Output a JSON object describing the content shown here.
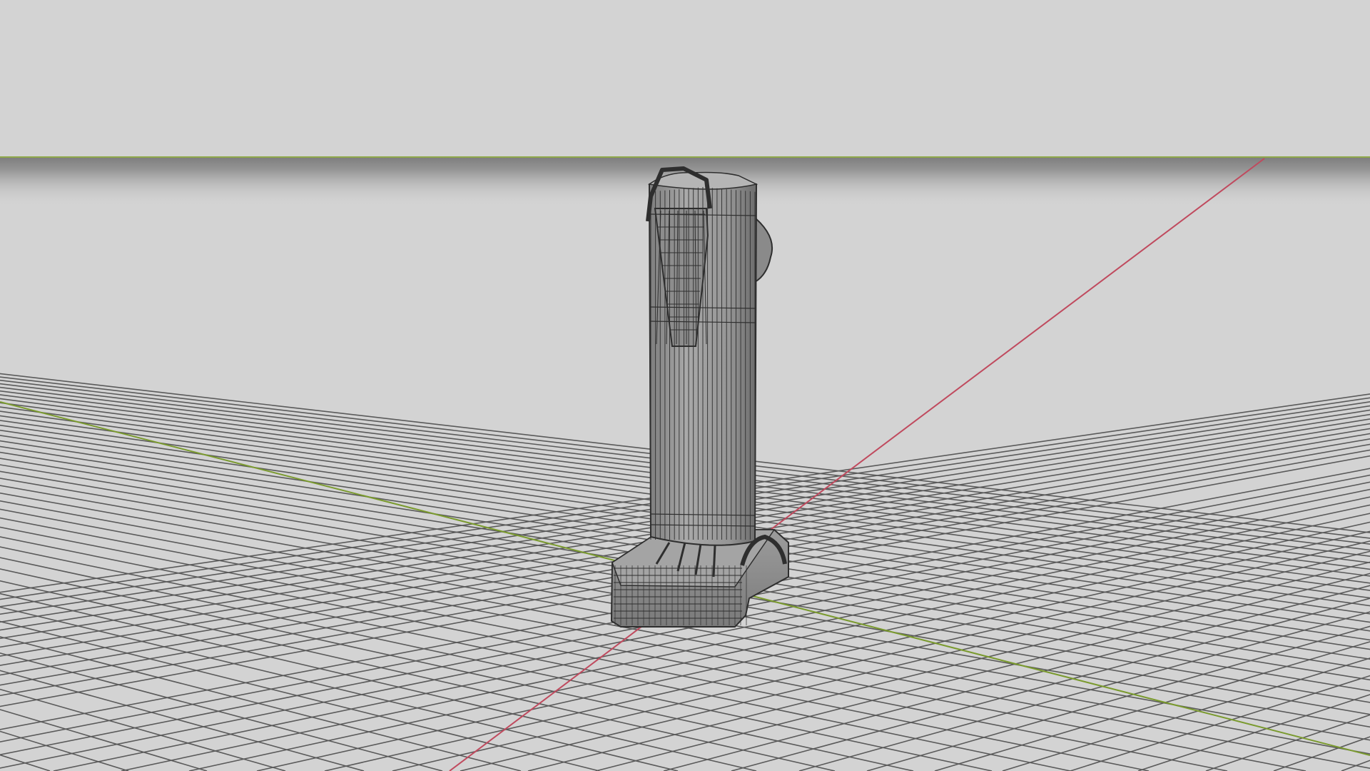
{
  "viewport": {
    "kind": "3d-perspective-viewport",
    "shading": "wireframe-on-shaded",
    "background_color": "#d3d3d3",
    "grid_visible": true,
    "grid_line_color": "#5a5a5a",
    "x_axis_color": "#c04a5e",
    "y_axis_color": "#7a9a2e",
    "horizon_color": "#8fa84a"
  },
  "scene_object": {
    "name": "cylinder-post-with-base",
    "body_color": "#9a9a9a",
    "wire_color": "#2e2e2e"
  }
}
